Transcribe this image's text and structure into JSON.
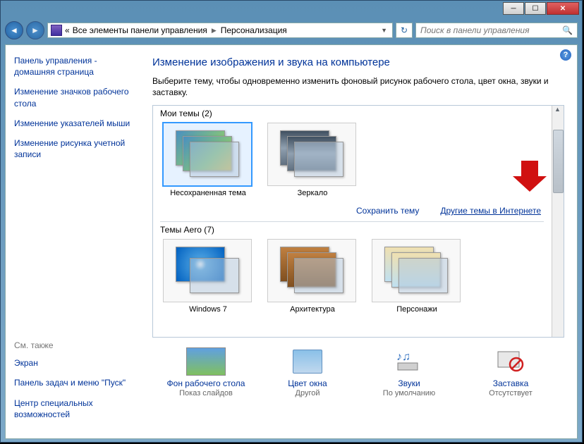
{
  "breadcrumb": {
    "prefix": "«",
    "item1": "Все элементы панели управления",
    "item2": "Персонализация"
  },
  "search": {
    "placeholder": "Поиск в панели управления"
  },
  "sidebar": {
    "home": "Панель управления - домашняя страница",
    "links": [
      "Изменение значков рабочего стола",
      "Изменение указателей мыши",
      "Изменение рисунка учетной записи"
    ],
    "see_also_hdr": "См. также",
    "see_also": [
      "Экран",
      "Панель задач и меню \"Пуск\"",
      "Центр специальных возможностей"
    ]
  },
  "main": {
    "title": "Изменение изображения и звука на компьютере",
    "subtitle": "Выберите тему, чтобы одновременно изменить фоновый рисунок рабочего стола, цвет окна, звуки и заставку.",
    "my_themes_hdr": "Мои темы (2)",
    "my_themes": [
      {
        "label": "Несохраненная тема"
      },
      {
        "label": "Зеркало"
      }
    ],
    "save_link": "Сохранить тему",
    "online_link": "Другие темы в Интернете",
    "aero_hdr": "Темы Aero (7)",
    "aero_themes": [
      {
        "label": "Windows 7"
      },
      {
        "label": "Архитектура"
      },
      {
        "label": "Персонажи"
      }
    ]
  },
  "bottom": [
    {
      "label": "Фон рабочего стола",
      "sub": "Показ слайдов"
    },
    {
      "label": "Цвет окна",
      "sub": "Другой"
    },
    {
      "label": "Звуки",
      "sub": "По умолчанию"
    },
    {
      "label": "Заставка",
      "sub": "Отсутствует"
    }
  ]
}
